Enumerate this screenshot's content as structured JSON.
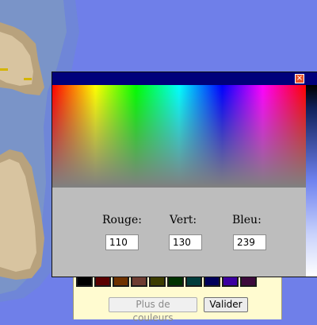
{
  "dialog": {
    "close_symbol": "×",
    "labels": {
      "red": "Rouge:",
      "green": "Vert:",
      "blue": "Bleu:"
    },
    "values": {
      "red": "110",
      "green": "130",
      "blue": "239"
    }
  },
  "palette": {
    "swatch_colors": [
      "#000000",
      "#5a0000",
      "#6e3200",
      "#6e3c32",
      "#3c3c00",
      "#003200",
      "#003c3c",
      "#00005a",
      "#3c00a0",
      "#3c0a3c"
    ],
    "more_colors_label": "Plus de couleurs",
    "validate_label": "Valider"
  },
  "colors": {
    "sea": "#6f7fe9",
    "title_bar": "#00007b",
    "dialog_bg": "#bdbdbd",
    "close_button": "#e8532b",
    "palette_bg": "#fffbd0"
  }
}
